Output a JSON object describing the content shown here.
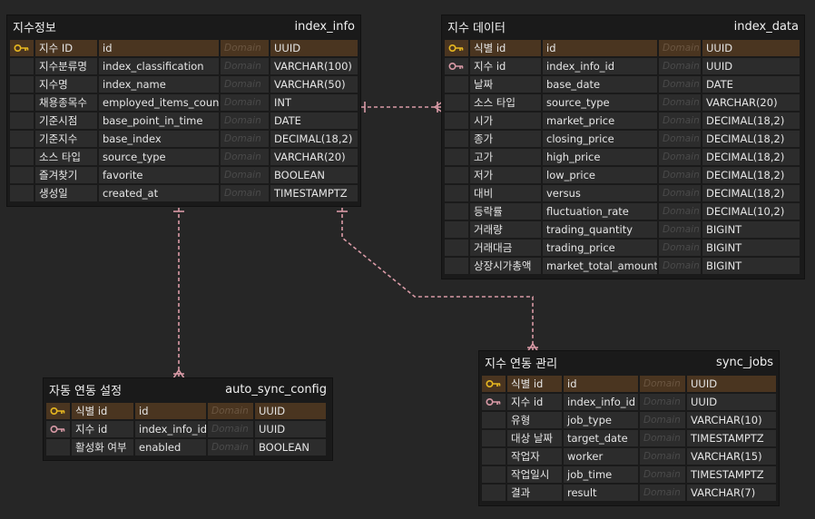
{
  "colors": {
    "fk_line": "#d99aa6",
    "pk_row": "#4a3520",
    "key_gold": "#e8b820",
    "key_pink": "#d99aa6"
  },
  "domain_placeholder": "Domain",
  "entities": {
    "index_info": {
      "display_name": "지수정보",
      "table_name": "index_info",
      "rows": [
        {
          "label": "지수 ID",
          "column": "id",
          "type": "UUID",
          "key": "pk"
        },
        {
          "label": "지수분류명",
          "column": "index_classification",
          "type": "VARCHAR(100)",
          "key": ""
        },
        {
          "label": "지수명",
          "column": "index_name",
          "type": "VARCHAR(50)",
          "key": ""
        },
        {
          "label": "채용종목수",
          "column": "employed_items_count",
          "type": "INT",
          "key": ""
        },
        {
          "label": "기준시점",
          "column": "base_point_in_time",
          "type": "DATE",
          "key": ""
        },
        {
          "label": "기준지수",
          "column": "base_index",
          "type": "DECIMAL(18,2)",
          "key": ""
        },
        {
          "label": "소스 타입",
          "column": "source_type",
          "type": "VARCHAR(20)",
          "key": ""
        },
        {
          "label": "즐겨찾기",
          "column": "favorite",
          "type": "BOOLEAN",
          "key": ""
        },
        {
          "label": "생성일",
          "column": "created_at",
          "type": "TIMESTAMPTZ",
          "key": ""
        }
      ]
    },
    "index_data": {
      "display_name": "지수 데이터",
      "table_name": "index_data",
      "rows": [
        {
          "label": "식별 id",
          "column": "id",
          "type": "UUID",
          "key": "pk"
        },
        {
          "label": "지수 id",
          "column": "index_info_id",
          "type": "UUID",
          "key": "fk"
        },
        {
          "label": "날짜",
          "column": "base_date",
          "type": "DATE",
          "key": ""
        },
        {
          "label": "소스 타입",
          "column": "source_type",
          "type": "VARCHAR(20)",
          "key": ""
        },
        {
          "label": "시가",
          "column": "market_price",
          "type": "DECIMAL(18,2)",
          "key": ""
        },
        {
          "label": "종가",
          "column": "closing_price",
          "type": "DECIMAL(18,2)",
          "key": ""
        },
        {
          "label": "고가",
          "column": "high_price",
          "type": "DECIMAL(18,2)",
          "key": ""
        },
        {
          "label": "저가",
          "column": "low_price",
          "type": "DECIMAL(18,2)",
          "key": ""
        },
        {
          "label": "대비",
          "column": "versus",
          "type": "DECIMAL(18,2)",
          "key": ""
        },
        {
          "label": "등락률",
          "column": "fluctuation_rate",
          "type": "DECIMAL(10,2)",
          "key": ""
        },
        {
          "label": "거래량",
          "column": "trading_quantity",
          "type": "BIGINT",
          "key": ""
        },
        {
          "label": "거래대금",
          "column": "trading_price",
          "type": "BIGINT",
          "key": ""
        },
        {
          "label": "상장시가총액",
          "column": "market_total_amount",
          "type": "BIGINT",
          "key": ""
        }
      ]
    },
    "auto_sync_config": {
      "display_name": "자동 연동 설정",
      "table_name": "auto_sync_config",
      "rows": [
        {
          "label": "식별 id",
          "column": "id",
          "type": "UUID",
          "key": "pk"
        },
        {
          "label": "지수 id",
          "column": "index_info_id",
          "type": "UUID",
          "key": "fk"
        },
        {
          "label": "활성화 여부",
          "column": "enabled",
          "type": "BOOLEAN",
          "key": ""
        }
      ]
    },
    "sync_jobs": {
      "display_name": "지수 연동 관리",
      "table_name": "sync_jobs",
      "rows": [
        {
          "label": "식별 id",
          "column": "id",
          "type": "UUID",
          "key": "pk"
        },
        {
          "label": "지수 id",
          "column": "index_info_id",
          "type": "UUID",
          "key": "fk"
        },
        {
          "label": "유형",
          "column": "job_type",
          "type": "VARCHAR(10)",
          "key": ""
        },
        {
          "label": "대상 날짜",
          "column": "target_date",
          "type": "TIMESTAMPTZ",
          "key": ""
        },
        {
          "label": "작업자",
          "column": "worker",
          "type": "VARCHAR(15)",
          "key": ""
        },
        {
          "label": "작업일시",
          "column": "job_time",
          "type": "TIMESTAMPTZ",
          "key": ""
        },
        {
          "label": "결과",
          "column": "result",
          "type": "VARCHAR(7)",
          "key": ""
        }
      ]
    }
  }
}
